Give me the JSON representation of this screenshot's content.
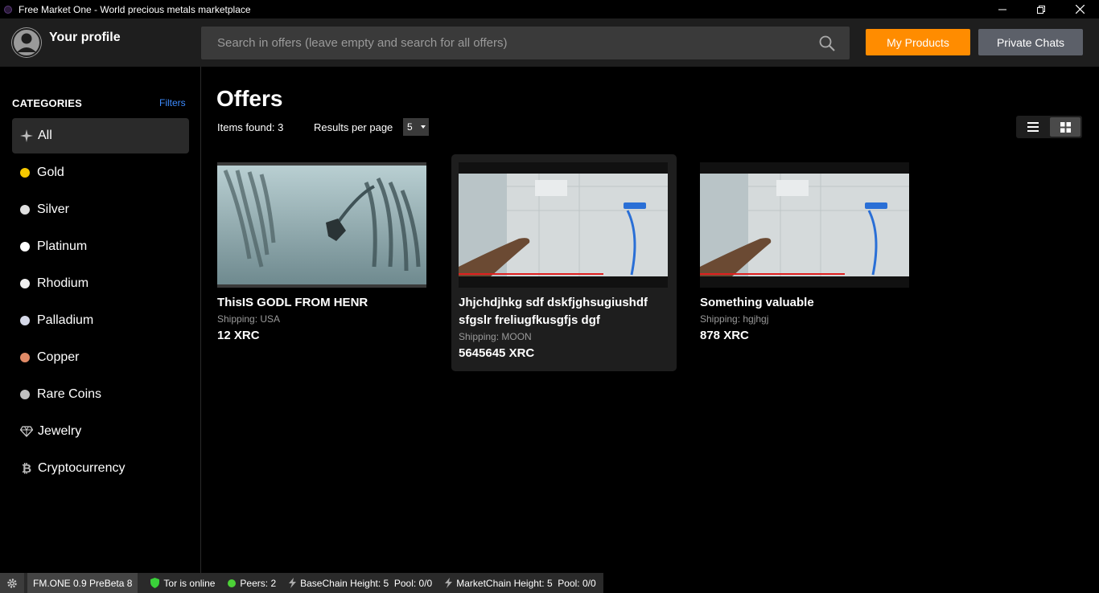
{
  "window": {
    "title": "Free Market One - World precious metals marketplace"
  },
  "header": {
    "profile_label": "Your profile",
    "search_placeholder": "Search in offers (leave empty and search for all offers)",
    "my_products_label": "My Products",
    "private_chats_label": "Private Chats"
  },
  "sidebar": {
    "header": "CATEGORIES",
    "filters_label": "Filters",
    "items": [
      {
        "label": "All",
        "icon": "sparkle-icon"
      },
      {
        "label": "Gold",
        "color": "#f5c800"
      },
      {
        "label": "Silver",
        "color": "#e0e0e0"
      },
      {
        "label": "Platinum",
        "color": "#ffffff"
      },
      {
        "label": "Rhodium",
        "color": "#f0f0f0"
      },
      {
        "label": "Palladium",
        "color": "#d6d9e8"
      },
      {
        "label": "Copper",
        "color": "#e08a66"
      },
      {
        "label": "Rare Coins",
        "color": "#c0c0c0"
      },
      {
        "label": "Jewelry",
        "icon": "diamond-icon"
      },
      {
        "label": "Cryptocurrency",
        "icon": "bitcoin-icon"
      }
    ]
  },
  "main": {
    "title": "Offers",
    "items_found": "Items found: 3",
    "results_per_page_label": "Results per page",
    "results_per_page_value": "5",
    "offers": [
      {
        "title": "ThisIS GODL FROM HENR",
        "shipping": "Shipping: USA",
        "price": "12 XRC"
      },
      {
        "title": "Jhjchdjhkg sdf dskfjghsugiushdf sfgslr freliugfkusgfjs dgf",
        "shipping": "Shipping: MOON",
        "price": "5645645 XRC"
      },
      {
        "title": "Something valuable",
        "shipping": "Shipping: hgjhgj",
        "price": "878 XRC"
      }
    ]
  },
  "statusbar": {
    "version": "FM.ONE 0.9 PreBeta 8",
    "tor": "Tor is online",
    "peers": "Peers: 2",
    "basechain": "BaseChain Height: 5  Pool: 0/0",
    "marketchain": "MarketChain Height: 5  Pool: 0/0"
  },
  "colors": {
    "accent": "#ff8c00",
    "secondary": "#5c6069",
    "link": "#3d8bff",
    "tor_green": "#3ad13a",
    "peers_green": "#4cd137"
  }
}
